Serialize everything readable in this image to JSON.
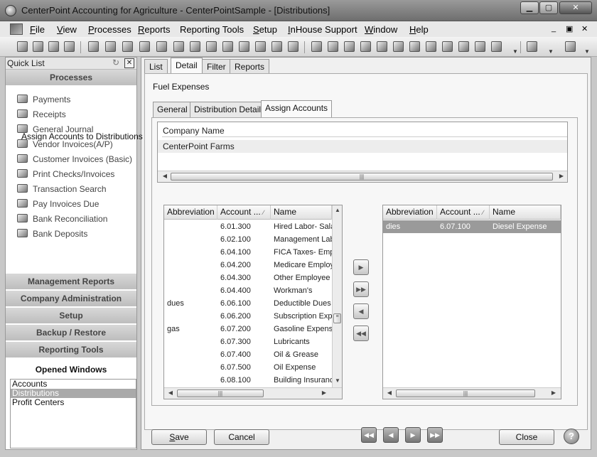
{
  "window": {
    "title": "CenterPoint Accounting for Agriculture - CenterPointSample - [Distributions]",
    "min_glyph": "▁",
    "max_glyph": "▢",
    "close_glyph": "✕"
  },
  "menubar": {
    "items": [
      {
        "accel": "F",
        "rest": "ile"
      },
      {
        "accel": "V",
        "rest": "iew"
      },
      {
        "accel": "P",
        "rest": "rocesses"
      },
      {
        "accel": "R",
        "rest": "eports"
      },
      {
        "accel": "",
        "rest": "Reporting Tools"
      },
      {
        "accel": "S",
        "rest": "etup"
      },
      {
        "accel": "I",
        "rest": "nHouse Support"
      },
      {
        "accel": "W",
        "rest": "indow"
      },
      {
        "accel": "H",
        "rest": "elp"
      }
    ],
    "mdi_min": "_",
    "mdi_restore": "▣",
    "mdi_close": "✕"
  },
  "quick_list": {
    "title": "Quick List",
    "processes_header": "Processes",
    "processes": [
      {
        "label": "Payments",
        "icon": "payments-icon"
      },
      {
        "label": "Receipts",
        "icon": "receipts-icon"
      },
      {
        "label": "General Journal",
        "icon": "journal-icon"
      },
      {
        "label": "Vendor Invoices(A/P)",
        "icon": "vendor-invoice-icon"
      },
      {
        "label": "Customer Invoices (Basic)",
        "icon": "customer-invoice-icon"
      },
      {
        "label": "Print Checks/Invoices",
        "icon": "printer-icon"
      },
      {
        "label": "Transaction Search",
        "icon": "search-icon"
      },
      {
        "label": "Pay Invoices Due",
        "icon": "pay-invoices-icon"
      },
      {
        "label": "Bank Reconciliation",
        "icon": "bank-reconcile-icon"
      },
      {
        "label": "Bank Deposits",
        "icon": "bank-deposit-icon"
      }
    ],
    "sections": [
      "Management Reports",
      "Company Administration",
      "Setup",
      "Backup / Restore",
      "Reporting Tools"
    ],
    "opened_windows_header": "Opened Windows",
    "opened_windows": [
      "Accounts",
      "Distributions",
      "Profit Centers"
    ],
    "selected_window_index": 1
  },
  "tabs": [
    "List",
    "Detail",
    "Filter",
    "Reports"
  ],
  "active_tab_index": 1,
  "record_title": "Fuel Expenses",
  "subtabs": [
    "General",
    "Distribution Detail",
    "Assign Accounts"
  ],
  "active_subtab_index": 2,
  "company_grid": {
    "header": "Company Name",
    "rows": [
      "CenterPoint Farms"
    ]
  },
  "assign_group_label": "Assign Accounts to Distributions",
  "columns": {
    "abbreviation": "Abbreviation",
    "account": "Account ...",
    "name": "Name"
  },
  "available_accounts": [
    {
      "abbr": "",
      "account": "6.01.300",
      "name": "Hired Labor- Sala"
    },
    {
      "abbr": "",
      "account": "6.02.100",
      "name": "Management Lab"
    },
    {
      "abbr": "",
      "account": "6.04.100",
      "name": "FICA Taxes- Emp"
    },
    {
      "abbr": "",
      "account": "6.04.200",
      "name": "Medicare Employ"
    },
    {
      "abbr": "",
      "account": "6.04.300",
      "name": "Other Employee"
    },
    {
      "abbr": "",
      "account": "6.04.400",
      "name": "Workman's"
    },
    {
      "abbr": "dues",
      "account": "6.06.100",
      "name": "Deductible Dues"
    },
    {
      "abbr": "",
      "account": "6.06.200",
      "name": "Subscription Expe"
    },
    {
      "abbr": "gas",
      "account": "6.07.200",
      "name": "Gasoline Expense"
    },
    {
      "abbr": "",
      "account": "6.07.300",
      "name": "Lubricants"
    },
    {
      "abbr": "",
      "account": "6.07.400",
      "name": "Oil & Grease"
    },
    {
      "abbr": "",
      "account": "6.07.500",
      "name": "Oil Expense"
    },
    {
      "abbr": "",
      "account": "6.08.100",
      "name": "Building Insuranc"
    }
  ],
  "assigned_accounts": [
    {
      "abbr": "dies",
      "account": "6.07.100",
      "name": "Diesel Expense"
    }
  ],
  "move_buttons": {
    "add": "▶",
    "add_all": "▶▶",
    "remove": "◀",
    "remove_all": "◀◀"
  },
  "scroll_glyphs": {
    "left": "◀",
    "right": "▶",
    "up": "▲",
    "down": "▼",
    "grip": "|||"
  },
  "footer": {
    "save_accel": "S",
    "save_rest": "ave",
    "cancel": "Cancel",
    "close": "Close",
    "help": "?",
    "nav_first": "◀◀",
    "nav_prev": "◀",
    "nav_next": "▶",
    "nav_last": "▶▶"
  }
}
